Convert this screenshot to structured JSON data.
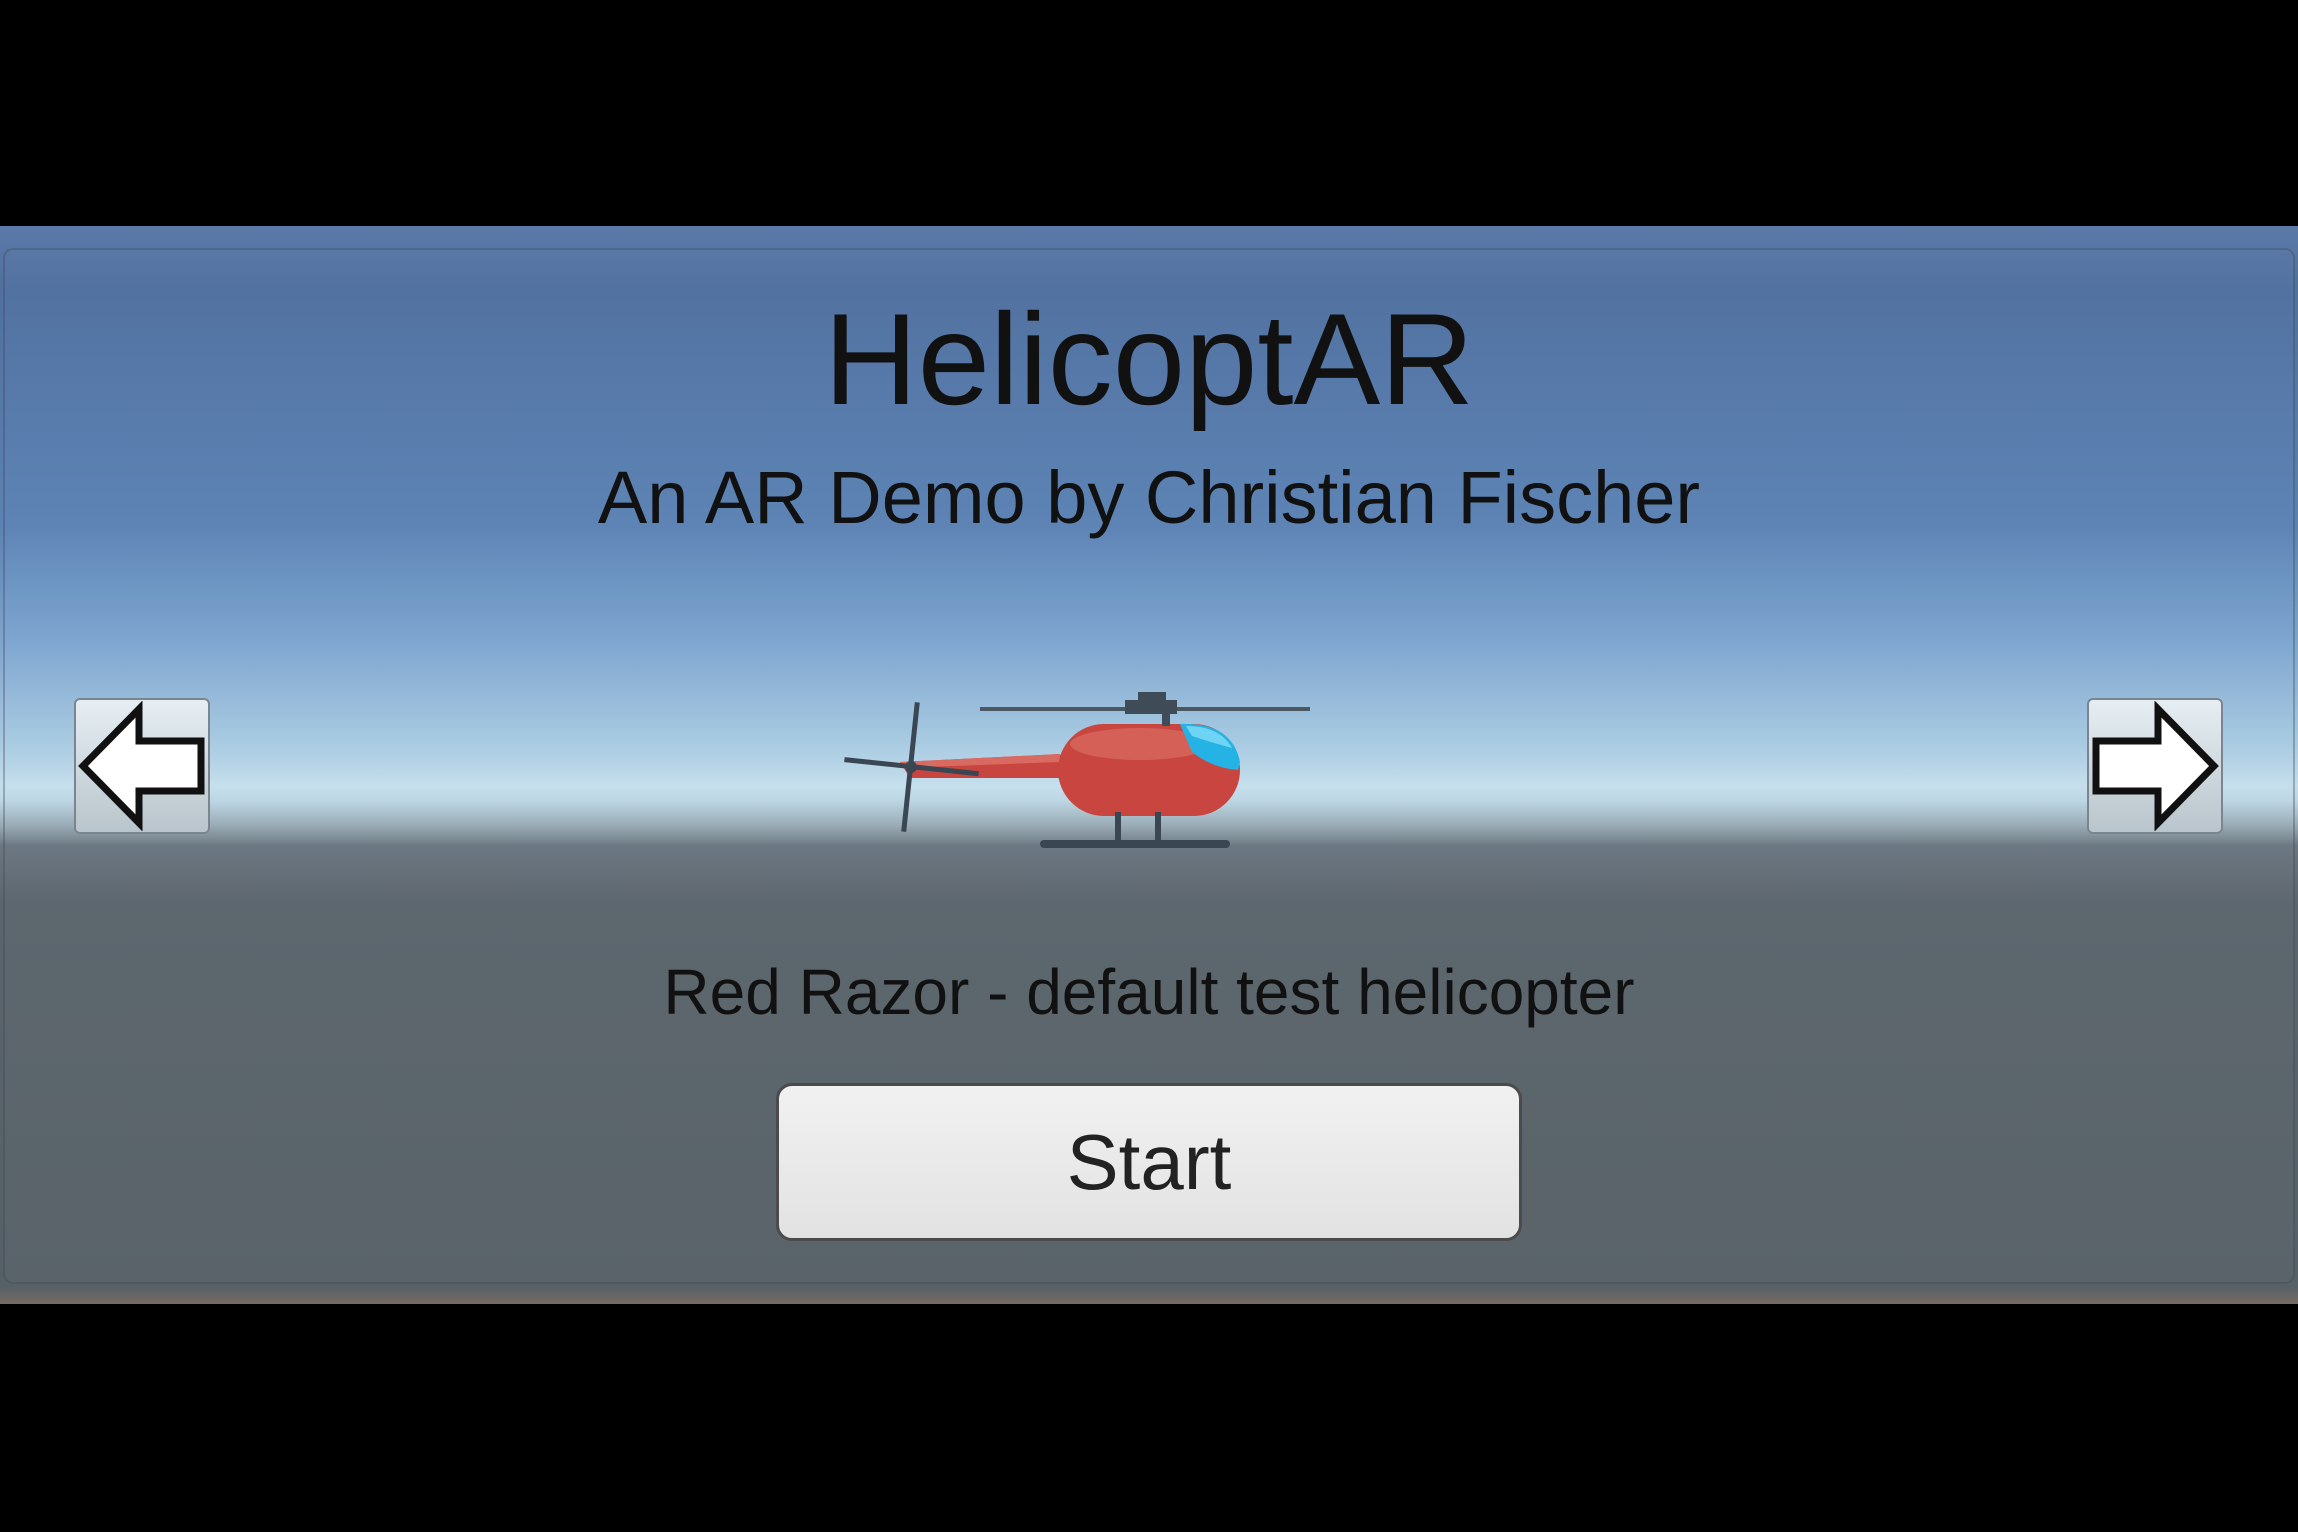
{
  "app": {
    "title": "HelicoptAR",
    "subtitle": "An AR Demo by Christian Fischer"
  },
  "selection": {
    "description": "Red Razor - default test helicopter",
    "model_icon": "helicopter-model"
  },
  "navigation": {
    "prev_icon": "arrow-left-icon",
    "next_icon": "arrow-right-icon"
  },
  "actions": {
    "start_label": "Start"
  },
  "colors": {
    "helicopter_body": "#c9453f",
    "helicopter_cockpit": "#25b3e6",
    "sky_top": "#4f70a0",
    "ground": "#566067"
  }
}
